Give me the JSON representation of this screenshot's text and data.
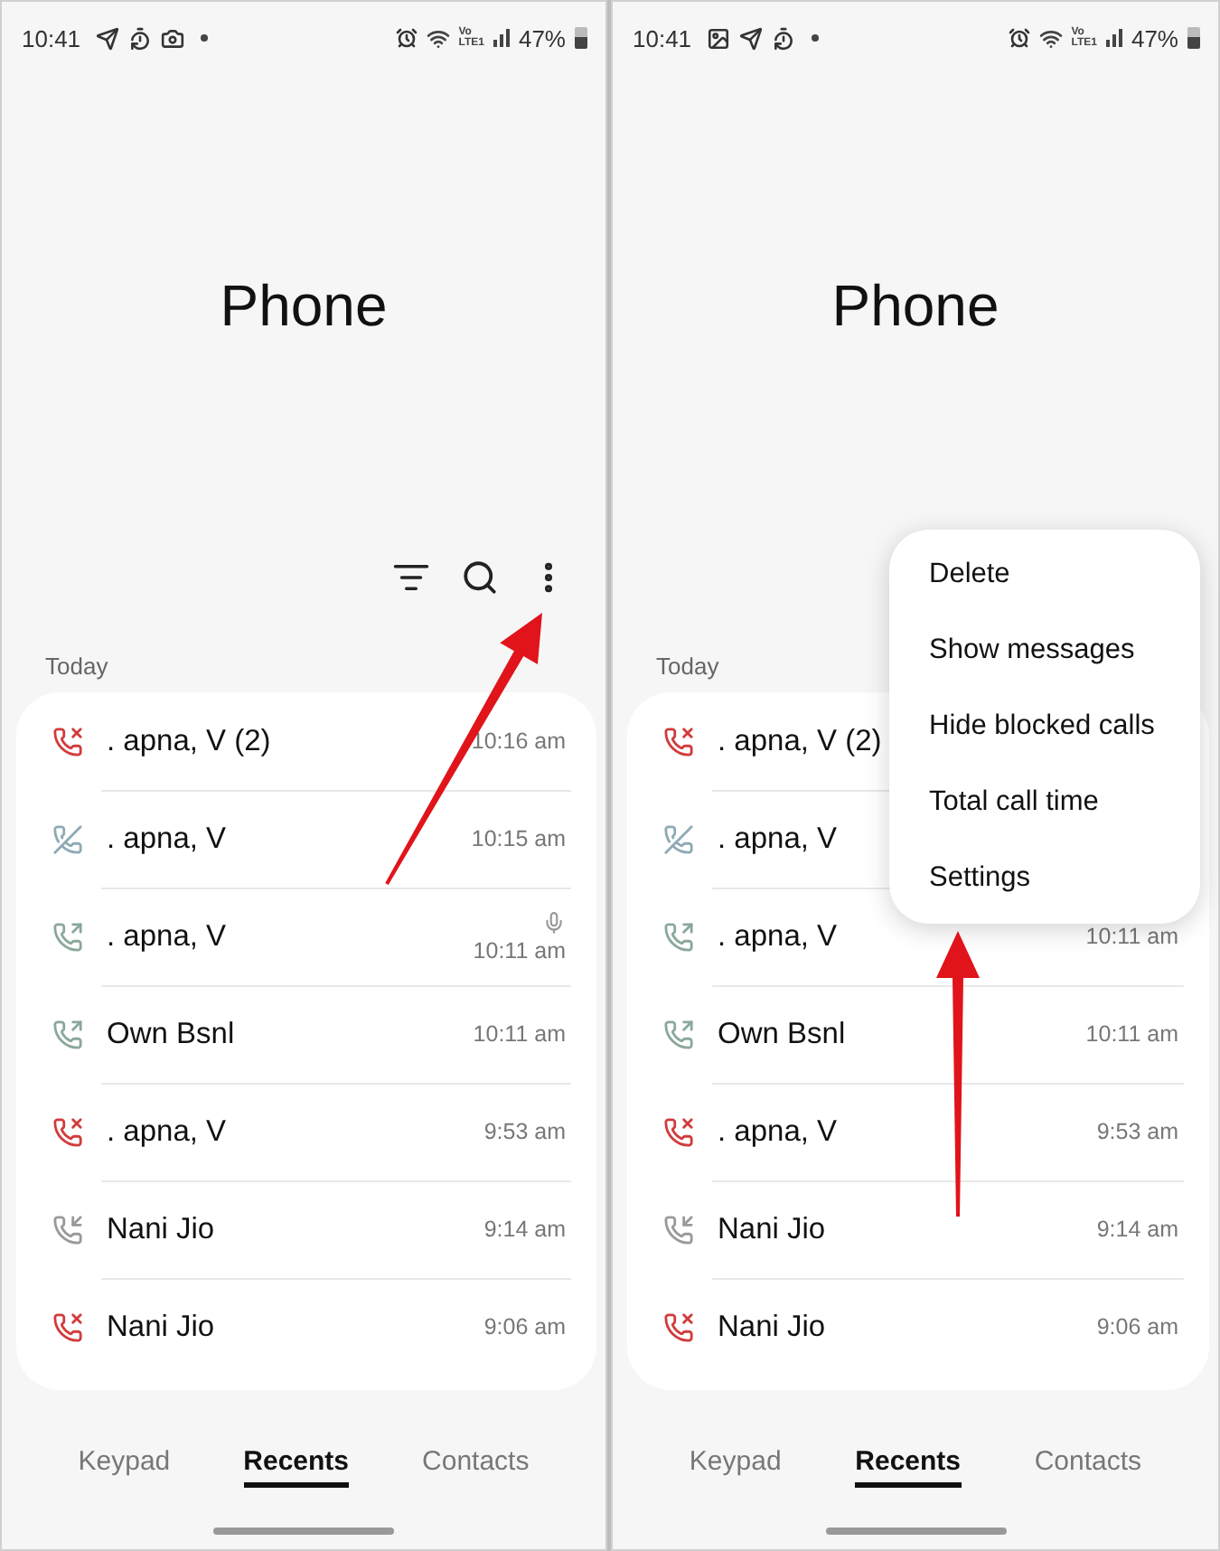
{
  "panels": [
    {
      "status_bar": {
        "time": "10:41",
        "notifications": [
          {
            "kind": "send"
          },
          {
            "kind": "timer"
          },
          {
            "kind": "camera"
          },
          {
            "kind": "dot"
          }
        ],
        "volte": "Vo",
        "lte": "LTE1",
        "battery": "47%"
      },
      "title": "Phone",
      "section": "Today",
      "calls": [
        {
          "name": ". apna, V (2)",
          "time": "10:16 am",
          "kind": "missed",
          "recorded": false
        },
        {
          "name": ". apna, V",
          "time": "10:15 am",
          "kind": "blocked",
          "recorded": false
        },
        {
          "name": ". apna, V",
          "time": "10:11 am",
          "kind": "outgoing",
          "recorded": true
        },
        {
          "name": "Own Bsnl",
          "time": "10:11 am",
          "kind": "outgoing",
          "recorded": false
        },
        {
          "name": ". apna, V",
          "time": "9:53 am",
          "kind": "missed",
          "recorded": false
        },
        {
          "name": "Nani Jio",
          "time": "9:14 am",
          "kind": "incoming",
          "recorded": false
        },
        {
          "name": "Nani Jio",
          "time": "9:06 am",
          "kind": "missed",
          "recorded": false
        }
      ],
      "tabs": [
        {
          "label": "Keypad",
          "selected": false
        },
        {
          "label": "Recents",
          "selected": true
        },
        {
          "label": "Contacts",
          "selected": false
        }
      ],
      "arrow": {
        "kind": "diagonal"
      }
    },
    {
      "status_bar": {
        "time": "10:41",
        "notifications": [
          {
            "kind": "image"
          },
          {
            "kind": "send"
          },
          {
            "kind": "timer"
          },
          {
            "kind": "dot"
          }
        ],
        "volte": "Vo",
        "lte": "LTE1",
        "battery": "47%"
      },
      "title": "Phone",
      "section": "Today",
      "calls": [
        {
          "name": ". apna, V (2)",
          "kind": "missed"
        },
        {
          "name": ". apna, V",
          "kind": "blocked"
        },
        {
          "name": ". apna, V",
          "time": "10:11 am",
          "kind": "outgoing"
        },
        {
          "name": "Own Bsnl",
          "time": "10:11 am",
          "kind": "outgoing"
        },
        {
          "name": ". apna, V",
          "time": "9:53 am",
          "kind": "missed"
        },
        {
          "name": "Nani Jio",
          "time": "9:14 am",
          "kind": "incoming"
        },
        {
          "name": "Nani Jio",
          "time": "9:06 am",
          "kind": "missed"
        }
      ],
      "tabs": [
        {
          "label": "Keypad",
          "selected": false
        },
        {
          "label": "Recents",
          "selected": true
        },
        {
          "label": "Contacts",
          "selected": false
        }
      ],
      "menu": {
        "items": [
          "Delete",
          "Show messages",
          "Hide blocked calls",
          "Total call time",
          "Settings"
        ]
      },
      "arrow": {
        "kind": "vertical"
      }
    }
  ]
}
